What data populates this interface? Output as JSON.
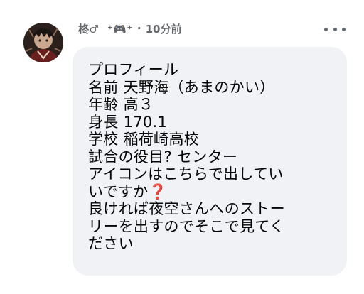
{
  "post": {
    "author_name": "柊♂︎︎︎︎︎︎ ︎︎︎︎︎ ︎︎",
    "author_decoration": "⁺🎮⁺",
    "separator": "·",
    "timestamp": "10分前"
  },
  "message": {
    "lines": [
      "プロフィール",
      "名前 天野海（あまのかい）",
      "年齢 高３",
      "身長 170.1",
      "学校 稲荷崎高校",
      "試合の役目?   センター",
      "アイコンはこちらで出してい",
      "いですか",
      "良ければ夜空さんへのストー",
      "リーを出すのでそこで見てく",
      "ださい"
    ],
    "emoji": "❓"
  },
  "icons": {
    "more": "more-options-icon",
    "avatar": "avatar"
  }
}
